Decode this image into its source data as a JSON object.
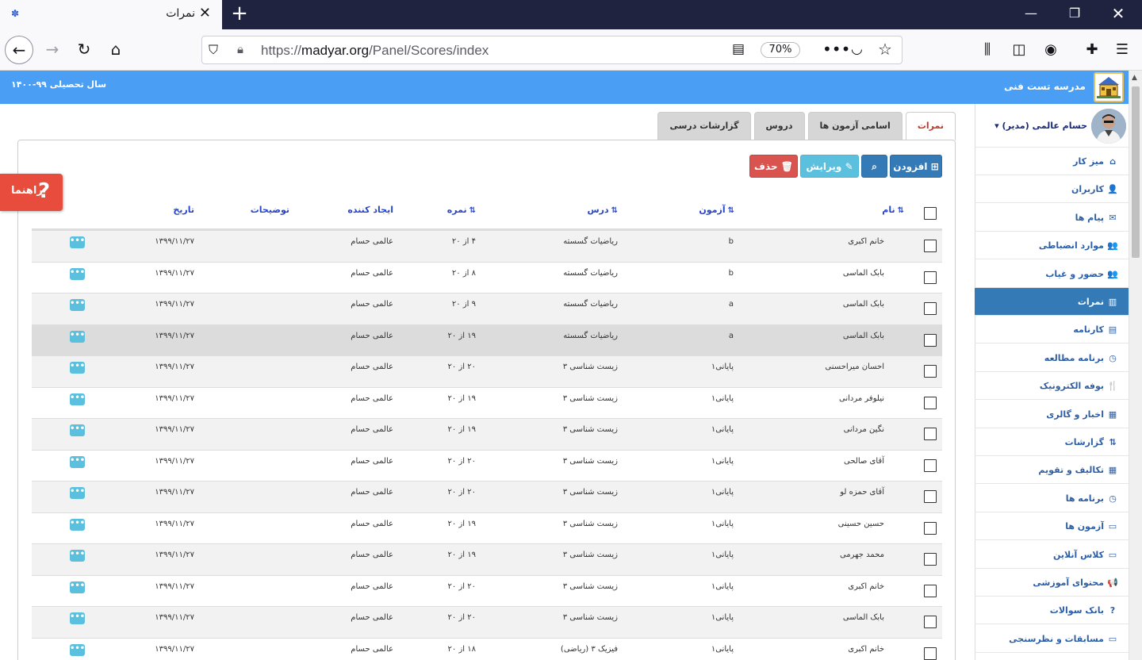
{
  "browser": {
    "tab_title": "نمرات",
    "url_prefix": "https://",
    "url_domain": "madyar.org",
    "url_path": "/Panel/Scores/index",
    "zoom": "70%"
  },
  "header": {
    "school_name": "مدرسه تست فنی",
    "academic_year": "سال تحصیلی ۹۹-۱۴۰۰"
  },
  "user": {
    "name": "حسام عالمی (مدیر)"
  },
  "sidebar": {
    "items": [
      {
        "label": "میز کار",
        "icon": "⌂"
      },
      {
        "label": "کاربران",
        "icon": "👤"
      },
      {
        "label": "پیام ها",
        "icon": "✉"
      },
      {
        "label": "موارد انضباطی",
        "icon": "👥"
      },
      {
        "label": "حضور و غیاب",
        "icon": "👥"
      },
      {
        "label": "نمرات",
        "icon": "▥",
        "active": true
      },
      {
        "label": "کارنامه",
        "icon": "▤"
      },
      {
        "label": "برنامه مطالعه",
        "icon": "◷"
      },
      {
        "label": "بوفه الکترونیک",
        "icon": "🍴"
      },
      {
        "label": "اخبار و گالری",
        "icon": "▦"
      },
      {
        "label": "گزارشات",
        "icon": "⇅"
      },
      {
        "label": "تکالیف و تقویم",
        "icon": "▦"
      },
      {
        "label": "برنامه ها",
        "icon": "◷"
      },
      {
        "label": "آزمون ها",
        "icon": "▭"
      },
      {
        "label": "کلاس آنلاین",
        "icon": "▭"
      },
      {
        "label": "محتوای آموزشی",
        "icon": "📢"
      },
      {
        "label": "بانک سوالات",
        "icon": "?"
      },
      {
        "label": "مسابقات و نظرسنجی",
        "icon": "▭"
      }
    ]
  },
  "tabs": [
    {
      "label": "نمرات",
      "active": true
    },
    {
      "label": "اسامی آزمون ها"
    },
    {
      "label": "دروس"
    },
    {
      "label": "گزارشات درسی"
    }
  ],
  "actions": {
    "add": "افزودن",
    "edit": "ویرایش",
    "delete": "حذف"
  },
  "help": {
    "label": "راهنما"
  },
  "table": {
    "headers": {
      "name": "نام",
      "exam": "آزمون",
      "course": "درس",
      "score": "نمره",
      "creator": "ایجاد کننده",
      "description": "توضیحات",
      "date": "تاریخ"
    },
    "rows": [
      {
        "name": "خانم اکبری",
        "exam": "b",
        "course": "ریاضیات گسسته",
        "score": "۴ از ۲۰",
        "creator": "عالمی حسام",
        "date": "۱۳۹۹/۱۱/۲۷"
      },
      {
        "name": "بابک الماسی",
        "exam": "b",
        "course": "ریاضیات گسسته",
        "score": "۸ از ۲۰",
        "creator": "عالمی حسام",
        "date": "۱۳۹۹/۱۱/۲۷"
      },
      {
        "name": "بابک الماسی",
        "exam": "a",
        "course": "ریاضیات گسسته",
        "score": "۹ از ۲۰",
        "creator": "عالمی حسام",
        "date": "۱۳۹۹/۱۱/۲۷"
      },
      {
        "name": "بابک الماسی",
        "exam": "a",
        "course": "ریاضیات گسسته",
        "score": "۱۹ از ۲۰",
        "creator": "عالمی حسام",
        "date": "۱۳۹۹/۱۱/۲۷"
      },
      {
        "name": "احسان میراحسنی",
        "exam": "پایانی۱",
        "course": "زیست شناسی ۳",
        "score": "۲۰ از ۲۰",
        "creator": "عالمی حسام",
        "date": "۱۳۹۹/۱۱/۲۷"
      },
      {
        "name": "نیلوفر مردانی",
        "exam": "پایانی۱",
        "course": "زیست شناسی ۳",
        "score": "۱۹ از ۲۰",
        "creator": "عالمی حسام",
        "date": "۱۳۹۹/۱۱/۲۷"
      },
      {
        "name": "نگین مردانی",
        "exam": "پایانی۱",
        "course": "زیست شناسی ۳",
        "score": "۱۹ از ۲۰",
        "creator": "عالمی حسام",
        "date": "۱۳۹۹/۱۱/۲۷"
      },
      {
        "name": "آقای صالحی",
        "exam": "پایانی۱",
        "course": "زیست شناسی ۳",
        "score": "۲۰ از ۲۰",
        "creator": "عالمی حسام",
        "date": "۱۳۹۹/۱۱/۲۷"
      },
      {
        "name": "آقای حمزه لو",
        "exam": "پایانی۱",
        "course": "زیست شناسی ۳",
        "score": "۲۰ از ۲۰",
        "creator": "عالمی حسام",
        "date": "۱۳۹۹/۱۱/۲۷"
      },
      {
        "name": "حسین حسینی",
        "exam": "پایانی۱",
        "course": "زیست شناسی ۳",
        "score": "۱۹ از ۲۰",
        "creator": "عالمی حسام",
        "date": "۱۳۹۹/۱۱/۲۷"
      },
      {
        "name": "محمد جهرمی",
        "exam": "پایانی۱",
        "course": "زیست شناسی ۳",
        "score": "۱۹ از ۲۰",
        "creator": "عالمی حسام",
        "date": "۱۳۹۹/۱۱/۲۷"
      },
      {
        "name": "خانم اکبری",
        "exam": "پایانی۱",
        "course": "زیست شناسی ۳",
        "score": "۲۰ از ۲۰",
        "creator": "عالمی حسام",
        "date": "۱۳۹۹/۱۱/۲۷"
      },
      {
        "name": "بابک الماسی",
        "exam": "پایانی۱",
        "course": "زیست شناسی ۳",
        "score": "۲۰ از ۲۰",
        "creator": "عالمی حسام",
        "date": "۱۳۹۹/۱۱/۲۷"
      },
      {
        "name": "خانم اکبری",
        "exam": "پایانی۱",
        "course": "فیزیک ۳ (ریاضی)",
        "score": "۱۸ از ۲۰",
        "creator": "عالمی حسام",
        "date": "۱۳۹۹/۱۱/۲۷"
      }
    ]
  }
}
